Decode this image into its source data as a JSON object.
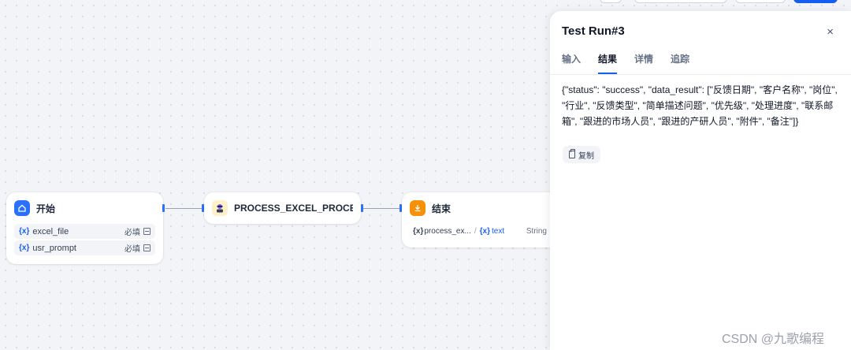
{
  "nodes": {
    "start": {
      "title": "开始",
      "variables": [
        {
          "mark": "{x}",
          "name": "excel_file",
          "required": "必填"
        },
        {
          "mark": "{x}",
          "name": "usr_prompt",
          "required": "必填"
        }
      ]
    },
    "process": {
      "title": "PROCESS_EXCEL_PROCESS_"
    },
    "end": {
      "title": "结束",
      "output": {
        "mark": "{x}",
        "source": "process_ex...",
        "sep": "/",
        "var_mark": "{x}",
        "var": "text",
        "type": "String"
      }
    }
  },
  "panel": {
    "title": "Test Run#3",
    "close": "×",
    "tabs": [
      "输入",
      "结果",
      "详情",
      "追踪"
    ],
    "active_tab": "结果",
    "result_text": "{\"status\": \"success\", \"data_result\": [\"反馈日期\", \"客户名称\", \"岗位\", \"行业\", \"反馈类型\", \"简单描述问题\", \"优先级\", \"处理进度\", \"联系邮箱\", \"跟进的市场人员\", \"跟进的产研人员\", \"附件\", \"备注\"]}",
    "copy_label": "复制"
  },
  "watermark": "CSDN @九歌编程",
  "colors": {
    "accent": "#155eef",
    "start_icon_bg": "#2970ff",
    "end_icon_bg": "#f79009",
    "process_icon_bg": "#fef0c7"
  }
}
